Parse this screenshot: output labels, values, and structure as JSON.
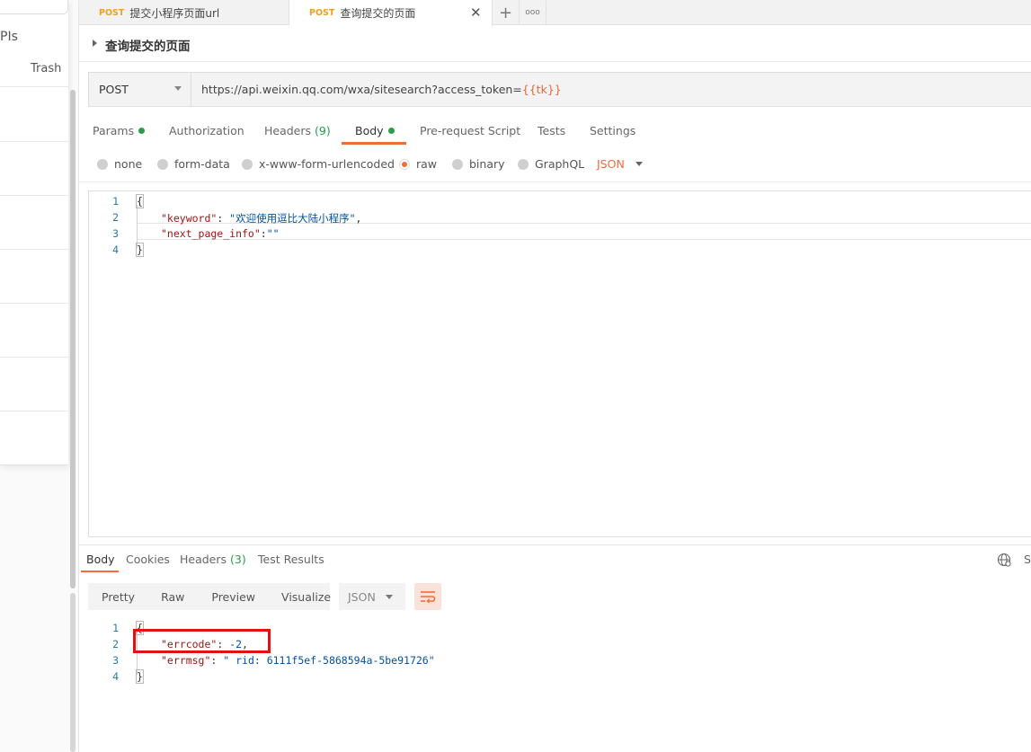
{
  "sidebar": {
    "apis_label": "PIs",
    "trash_label": "Trash"
  },
  "tabs": [
    {
      "method": "POST",
      "title": "提交小程序页面url"
    },
    {
      "method": "POST",
      "title": "查询提交的页面",
      "close": "✕"
    }
  ],
  "tab_actions": {
    "add": "+",
    "more": "ooo"
  },
  "request": {
    "title": "查询提交的页面",
    "method": "POST",
    "url_prefix": "https://api.weixin.qq.com/wxa/sitesearch?access_token=",
    "url_var": "{{tk}}"
  },
  "request_tabs": {
    "params": "Params",
    "authorization": "Authorization",
    "headers": "Headers",
    "headers_count": "(9)",
    "body": "Body",
    "prerequest": "Pre-request Script",
    "tests": "Tests",
    "settings": "Settings"
  },
  "body_types": {
    "none": "none",
    "form_data": "form-data",
    "urlencoded": "x-www-form-urlencoded",
    "raw": "raw",
    "binary": "binary",
    "graphql": "GraphQL",
    "language": "JSON",
    "selected": "raw"
  },
  "request_body": {
    "line_numbers": [
      "1",
      "2",
      "3",
      "4"
    ],
    "open_brace": "{",
    "line2_key": "\"keyword\"",
    "line2_sep": ": ",
    "line2_value": "\"欢迎使用逗比大陆小程序\"",
    "line2_end": ",",
    "line3_key": "\"next_page_info\"",
    "line3_sep": ":",
    "line3_value": "\"\"",
    "close_brace": "}"
  },
  "response_tabs": {
    "body": "Body",
    "cookies": "Cookies",
    "headers": "Headers",
    "headers_count": "(3)",
    "test_results": "Test Results",
    "status_cut": "St"
  },
  "response_toolbar": {
    "pretty": "Pretty",
    "raw": "Raw",
    "preview": "Preview",
    "visualize": "Visualize",
    "format": "JSON"
  },
  "response_body": {
    "line_numbers": [
      "1",
      "2",
      "3",
      "4"
    ],
    "open_brace": "{",
    "line2_key": "\"errcode\"",
    "line2_sep": ": ",
    "line2_value": "-2",
    "line2_end": ",",
    "line3_key": "\"errmsg\"",
    "line3_sep": ": ",
    "line3_value": "\" rid: 6111f5ef-5868594a-5be91726\"",
    "close_brace": "}"
  },
  "colors": {
    "accent": "#f26b3a",
    "method_post": "#f0a020",
    "success_dot": "#2a9d4a",
    "json_key": "#a31515",
    "json_string": "#0451a5",
    "annotation_box": "#e31212"
  }
}
